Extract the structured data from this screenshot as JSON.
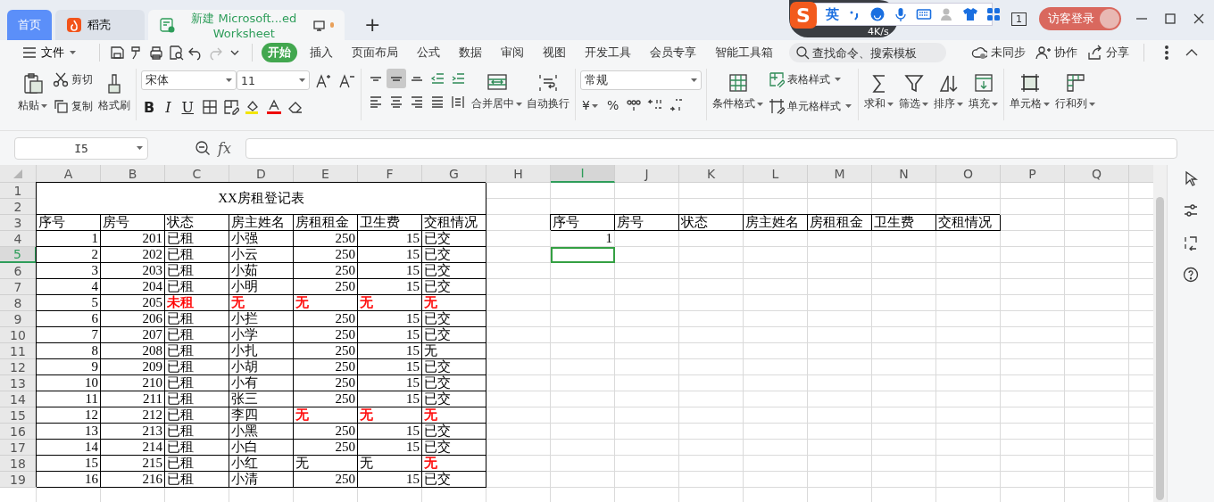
{
  "tabs": [
    {
      "label": "首页",
      "kind": "home",
      "selected": false
    },
    {
      "label": "稻壳",
      "kind": "docer",
      "selected": false
    },
    {
      "label": "新建 Microsoft...ed Worksheet",
      "kind": "sheet",
      "selected": true
    }
  ],
  "new_tab": "+",
  "ime": {
    "logo": "S",
    "mode": "英"
  },
  "speed": {
    "reading": "4K/s"
  },
  "page_indicator": "1",
  "login": "访客登录",
  "menu": {
    "file": "文件",
    "tabs": [
      {
        "label": "开始",
        "selected": true
      },
      {
        "label": "插入",
        "selected": false
      },
      {
        "label": "页面布局",
        "selected": false
      },
      {
        "label": "公式",
        "selected": false
      },
      {
        "label": "数据",
        "selected": false
      },
      {
        "label": "审阅",
        "selected": false
      },
      {
        "label": "视图",
        "selected": false
      },
      {
        "label": "开发工具",
        "selected": false
      },
      {
        "label": "会员专享",
        "selected": false
      },
      {
        "label": "智能工具箱",
        "selected": false
      }
    ],
    "search": {
      "placeholder": "查找命令、搜索模板"
    },
    "actions": [
      {
        "label": "未同步",
        "kind": "cloud"
      },
      {
        "label": "协作",
        "kind": "people"
      },
      {
        "label": "分享",
        "kind": "share"
      }
    ]
  },
  "ribbon": {
    "paste": "粘贴",
    "cut": "剪切",
    "copy": "复制",
    "painter": "格式刷",
    "font_family": "宋体",
    "font_size": "11",
    "styles": [
      "B",
      "I",
      "U"
    ],
    "align_buttons": [
      {
        "kind": "top",
        "selected": false
      },
      {
        "kind": "middle",
        "selected": true
      },
      {
        "kind": "bottom",
        "selected": false
      },
      {
        "kind": "outdent",
        "selected": false
      },
      {
        "kind": "indent",
        "selected": false
      },
      {
        "kind": "left",
        "selected": false
      },
      {
        "kind": "center",
        "selected": false
      },
      {
        "kind": "right",
        "selected": false
      },
      {
        "kind": "justify",
        "selected": false
      },
      {
        "kind": "distributed",
        "selected": false
      }
    ],
    "merge": "合并居中",
    "wrap": "自动换行",
    "number_format": "常规",
    "currency": "¥",
    "percent": "%",
    "conditional": "条件格式",
    "table_style": "表格样式",
    "cell_style": "单元格样式",
    "editing": [
      {
        "label": "求和",
        "kind": "sum"
      },
      {
        "label": "筛选",
        "kind": "filter"
      },
      {
        "label": "排序",
        "kind": "sort"
      },
      {
        "label": "填充",
        "kind": "fill"
      },
      {
        "label": "单元格",
        "kind": "cell"
      },
      {
        "label": "行和列",
        "kind": "rowcol"
      }
    ]
  },
  "formula_bar": {
    "name_box": "I5",
    "fx": "fx"
  },
  "sheet": {
    "columns": [
      {
        "label": "A",
        "selected": false
      },
      {
        "label": "B",
        "selected": false
      },
      {
        "label": "C",
        "selected": false
      },
      {
        "label": "D",
        "selected": false
      },
      {
        "label": "E",
        "selected": false
      },
      {
        "label": "F",
        "selected": false
      },
      {
        "label": "G",
        "selected": false
      },
      {
        "label": "H",
        "selected": false
      },
      {
        "label": "I",
        "selected": true
      },
      {
        "label": "J",
        "selected": false
      },
      {
        "label": "K",
        "selected": false
      },
      {
        "label": "L",
        "selected": false
      },
      {
        "label": "M",
        "selected": false
      },
      {
        "label": "N",
        "selected": false
      },
      {
        "label": "O",
        "selected": false
      },
      {
        "label": "P",
        "selected": false
      },
      {
        "label": "Q",
        "selected": false
      }
    ],
    "row_headers": [
      {
        "label": "1",
        "selected": false
      },
      {
        "label": "2",
        "selected": false
      },
      {
        "label": "3",
        "selected": false
      },
      {
        "label": "4",
        "selected": false
      },
      {
        "label": "5",
        "selected": true
      },
      {
        "label": "6",
        "selected": false
      },
      {
        "label": "7",
        "selected": false
      },
      {
        "label": "8",
        "selected": false
      },
      {
        "label": "9",
        "selected": false
      },
      {
        "label": "10",
        "selected": false
      },
      {
        "label": "11",
        "selected": false
      },
      {
        "label": "12",
        "selected": false
      },
      {
        "label": "13",
        "selected": false
      },
      {
        "label": "14",
        "selected": false
      },
      {
        "label": "15",
        "selected": false
      },
      {
        "label": "16",
        "selected": false
      },
      {
        "label": "17",
        "selected": false
      },
      {
        "label": "18",
        "selected": false
      },
      {
        "label": "19",
        "selected": false
      }
    ],
    "tables": [
      {
        "title": "XX房租登记表",
        "rows": [
          {
            "bordered": true,
            "cells": [
              {
                "text": "序号",
                "kind": "text"
              },
              {
                "text": "房号",
                "kind": "text"
              },
              {
                "text": "状态",
                "kind": "text"
              },
              {
                "text": "房主姓名",
                "kind": "text"
              },
              {
                "text": "房租租金",
                "kind": "text"
              },
              {
                "text": "卫生费",
                "kind": "text"
              },
              {
                "text": "交租情况",
                "kind": "text"
              }
            ]
          },
          {
            "bordered": true,
            "cells": [
              {
                "text": "1",
                "kind": "number"
              },
              {
                "text": "201",
                "kind": "number"
              },
              {
                "text": "已租",
                "kind": "text"
              },
              {
                "text": "小强",
                "kind": "text"
              },
              {
                "text": "250",
                "kind": "number"
              },
              {
                "text": "15",
                "kind": "number"
              },
              {
                "text": "已交",
                "kind": "text"
              }
            ]
          },
          {
            "bordered": true,
            "cells": [
              {
                "text": "2",
                "kind": "number"
              },
              {
                "text": "202",
                "kind": "number"
              },
              {
                "text": "已租",
                "kind": "text"
              },
              {
                "text": "小云",
                "kind": "text"
              },
              {
                "text": "250",
                "kind": "number"
              },
              {
                "text": "15",
                "kind": "number"
              },
              {
                "text": "已交",
                "kind": "text"
              }
            ]
          },
          {
            "bordered": true,
            "cells": [
              {
                "text": "3",
                "kind": "number"
              },
              {
                "text": "203",
                "kind": "number"
              },
              {
                "text": "已租",
                "kind": "text"
              },
              {
                "text": "小茹",
                "kind": "text"
              },
              {
                "text": "250",
                "kind": "number"
              },
              {
                "text": "15",
                "kind": "number"
              },
              {
                "text": "已交",
                "kind": "text"
              }
            ]
          },
          {
            "bordered": true,
            "cells": [
              {
                "text": "4",
                "kind": "number"
              },
              {
                "text": "204",
                "kind": "number"
              },
              {
                "text": "已租",
                "kind": "text"
              },
              {
                "text": "小明",
                "kind": "text"
              },
              {
                "text": "250",
                "kind": "number"
              },
              {
                "text": "15",
                "kind": "number"
              },
              {
                "text": "已交",
                "kind": "text"
              }
            ]
          },
          {
            "bordered": true,
            "cells": [
              {
                "text": "5",
                "kind": "number"
              },
              {
                "text": "205",
                "kind": "number"
              },
              {
                "text": "未租",
                "kind": "text",
                "color": "#ff0000"
              },
              {
                "text": "无",
                "kind": "text",
                "color": "#ff0000"
              },
              {
                "text": "无",
                "kind": "text",
                "color": "#ff0000"
              },
              {
                "text": "无",
                "kind": "text",
                "color": "#ff0000"
              },
              {
                "text": "无",
                "kind": "text",
                "color": "#ff0000"
              }
            ]
          },
          {
            "bordered": true,
            "cells": [
              {
                "text": "6",
                "kind": "number"
              },
              {
                "text": "206",
                "kind": "number"
              },
              {
                "text": "已租",
                "kind": "text"
              },
              {
                "text": "小拦",
                "kind": "text"
              },
              {
                "text": "250",
                "kind": "number"
              },
              {
                "text": "15",
                "kind": "number"
              },
              {
                "text": "已交",
                "kind": "text"
              }
            ]
          },
          {
            "bordered": true,
            "cells": [
              {
                "text": "7",
                "kind": "number"
              },
              {
                "text": "207",
                "kind": "number"
              },
              {
                "text": "已租",
                "kind": "text"
              },
              {
                "text": "小学",
                "kind": "text"
              },
              {
                "text": "250",
                "kind": "number"
              },
              {
                "text": "15",
                "kind": "number"
              },
              {
                "text": "已交",
                "kind": "text"
              }
            ]
          },
          {
            "bordered": true,
            "cells": [
              {
                "text": "8",
                "kind": "number"
              },
              {
                "text": "208",
                "kind": "number"
              },
              {
                "text": "已租",
                "kind": "text"
              },
              {
                "text": "小扎",
                "kind": "text"
              },
              {
                "text": "250",
                "kind": "number"
              },
              {
                "text": "15",
                "kind": "number"
              },
              {
                "text": "无",
                "kind": "text"
              }
            ]
          },
          {
            "bordered": true,
            "cells": [
              {
                "text": "9",
                "kind": "number"
              },
              {
                "text": "209",
                "kind": "number"
              },
              {
                "text": "已租",
                "kind": "text"
              },
              {
                "text": "小胡",
                "kind": "text"
              },
              {
                "text": "250",
                "kind": "number"
              },
              {
                "text": "15",
                "kind": "number"
              },
              {
                "text": "已交",
                "kind": "text"
              }
            ]
          },
          {
            "bordered": true,
            "cells": [
              {
                "text": "10",
                "kind": "number"
              },
              {
                "text": "210",
                "kind": "number"
              },
              {
                "text": "已租",
                "kind": "text"
              },
              {
                "text": "小有",
                "kind": "text"
              },
              {
                "text": "250",
                "kind": "number"
              },
              {
                "text": "15",
                "kind": "number"
              },
              {
                "text": "已交",
                "kind": "text"
              }
            ]
          },
          {
            "bordered": true,
            "cells": [
              {
                "text": "11",
                "kind": "number"
              },
              {
                "text": "211",
                "kind": "number"
              },
              {
                "text": "已租",
                "kind": "text"
              },
              {
                "text": "张三",
                "kind": "text"
              },
              {
                "text": "250",
                "kind": "number"
              },
              {
                "text": "15",
                "kind": "number"
              },
              {
                "text": "已交",
                "kind": "text"
              }
            ]
          },
          {
            "bordered": true,
            "cells": [
              {
                "text": "12",
                "kind": "number"
              },
              {
                "text": "212",
                "kind": "number"
              },
              {
                "text": "已租",
                "kind": "text"
              },
              {
                "text": "李四",
                "kind": "text"
              },
              {
                "text": "无",
                "kind": "text",
                "color": "#ff0000"
              },
              {
                "text": "无",
                "kind": "text",
                "color": "#ff0000"
              },
              {
                "text": "无",
                "kind": "text",
                "color": "#ff0000"
              }
            ]
          },
          {
            "bordered": true,
            "cells": [
              {
                "text": "13",
                "kind": "number"
              },
              {
                "text": "213",
                "kind": "number"
              },
              {
                "text": "已租",
                "kind": "text"
              },
              {
                "text": "小黑",
                "kind": "text"
              },
              {
                "text": "250",
                "kind": "number"
              },
              {
                "text": "15",
                "kind": "number"
              },
              {
                "text": "已交",
                "kind": "text"
              }
            ]
          },
          {
            "bordered": true,
            "cells": [
              {
                "text": "14",
                "kind": "number"
              },
              {
                "text": "214",
                "kind": "number"
              },
              {
                "text": "已租",
                "kind": "text"
              },
              {
                "text": "小白",
                "kind": "text"
              },
              {
                "text": "250",
                "kind": "number"
              },
              {
                "text": "15",
                "kind": "number"
              },
              {
                "text": "已交",
                "kind": "text"
              }
            ]
          },
          {
            "bordered": true,
            "cells": [
              {
                "text": "15",
                "kind": "number"
              },
              {
                "text": "215",
                "kind": "number"
              },
              {
                "text": "已租",
                "kind": "text"
              },
              {
                "text": "小红",
                "kind": "text"
              },
              {
                "text": "无",
                "kind": "text"
              },
              {
                "text": "无",
                "kind": "text"
              },
              {
                "text": "无",
                "kind": "text",
                "color": "#ff0000"
              }
            ]
          },
          {
            "bordered": true,
            "cells": [
              {
                "text": "16",
                "kind": "number"
              },
              {
                "text": "216",
                "kind": "number"
              },
              {
                "text": "已租",
                "kind": "text"
              },
              {
                "text": "小清",
                "kind": "text"
              },
              {
                "text": "250",
                "kind": "number"
              },
              {
                "text": "15",
                "kind": "number"
              },
              {
                "text": "已交",
                "kind": "text"
              }
            ]
          }
        ]
      },
      {
        "rows": [
          {
            "bordered": true,
            "cells": [
              {
                "text": "序号",
                "kind": "text"
              },
              {
                "text": "房号",
                "kind": "text"
              },
              {
                "text": "状态",
                "kind": "text"
              },
              {
                "text": "房主姓名",
                "kind": "text"
              },
              {
                "text": "房租租金",
                "kind": "text"
              },
              {
                "text": "卫生费",
                "kind": "text"
              },
              {
                "text": "交租情况",
                "kind": "text"
              }
            ]
          },
          {
            "bordered": false,
            "cells": [
              {
                "text": "1",
                "kind": "number"
              }
            ]
          }
        ]
      }
    ]
  }
}
